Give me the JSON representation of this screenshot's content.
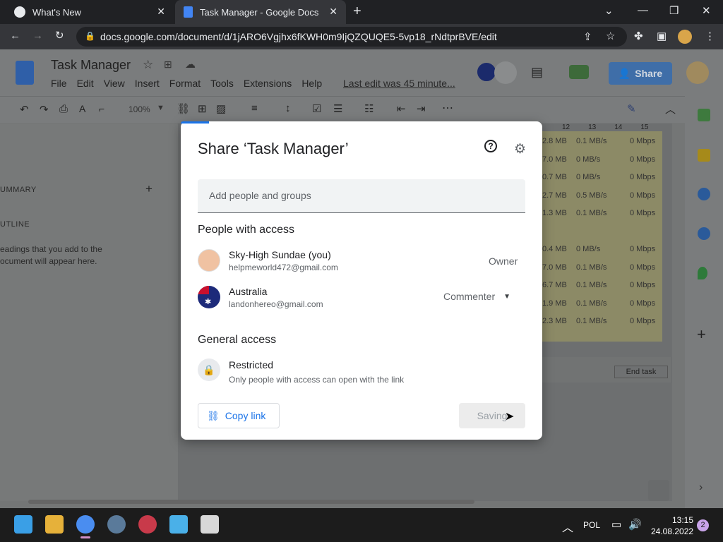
{
  "browser": {
    "tabs": [
      {
        "title": "What's New"
      },
      {
        "title": "Task Manager - Google Docs"
      }
    ],
    "url": "docs.google.com/document/d/1jARO6Vgjhx6fKWH0m9IjQZQUQE5-5vp18_rNdtprBVE/edit"
  },
  "doc": {
    "title": "Task Manager",
    "menus": [
      "File",
      "Edit",
      "View",
      "Insert",
      "Format",
      "Tools",
      "Extensions",
      "Help"
    ],
    "last_edit": "Last edit was 45 minute...",
    "share_label": "Share",
    "zoom": "100%",
    "outline": {
      "summary": "UMMARY",
      "outline": "UTLINE",
      "hint_line1": "eadings that you add to the",
      "hint_line2": "ocument will appear here."
    },
    "ruler": [
      "12",
      "13",
      "14",
      "15"
    ],
    "grid_rows": [
      [
        "2.8 MB",
        "0.1 MB/s",
        "0 Mbps"
      ],
      [
        "7.0 MB",
        "0 MB/s",
        "0 Mbps"
      ],
      [
        "0.7 MB",
        "0 MB/s",
        "0 Mbps"
      ],
      [
        "2.7 MB",
        "0.5 MB/s",
        "0 Mbps"
      ],
      [
        "1.3 MB",
        "0.1 MB/s",
        "0 Mbps"
      ],
      [
        "",
        "",
        ""
      ],
      [
        "0.4 MB",
        "0 MB/s",
        "0 Mbps"
      ],
      [
        "7.0 MB",
        "0.1 MB/s",
        "0 Mbps"
      ],
      [
        "6.7 MB",
        "0.1 MB/s",
        "0 Mbps"
      ],
      [
        "1.9 MB",
        "0.1 MB/s",
        "0 Mbps"
      ],
      [
        "2.3 MB",
        "0.1 MB/s",
        "0 Mbps"
      ]
    ],
    "end_task": "End task"
  },
  "dialog": {
    "title": "Share ‘Task Manager’",
    "add_placeholder": "Add people and groups",
    "people_heading": "People with access",
    "people": [
      {
        "name": "Sky-High Sundae (you)",
        "email": "helpmeworld472@gmail.com",
        "role": "Owner"
      },
      {
        "name": "Australia",
        "email": "landonhereo@gmail.com",
        "role": "Commenter"
      }
    ],
    "general_heading": "General access",
    "general_title": "Restricted",
    "general_desc": "Only people with access can open with the link",
    "copy_link": "Copy link",
    "saving": "Saving"
  },
  "taskbar": {
    "lang": "POL",
    "time": "13:15",
    "date": "24.08.2022",
    "badge": "2"
  },
  "colors": {
    "blue": "#1a73e8",
    "dialog_bg": "#ffffff",
    "dim": "#747676"
  }
}
